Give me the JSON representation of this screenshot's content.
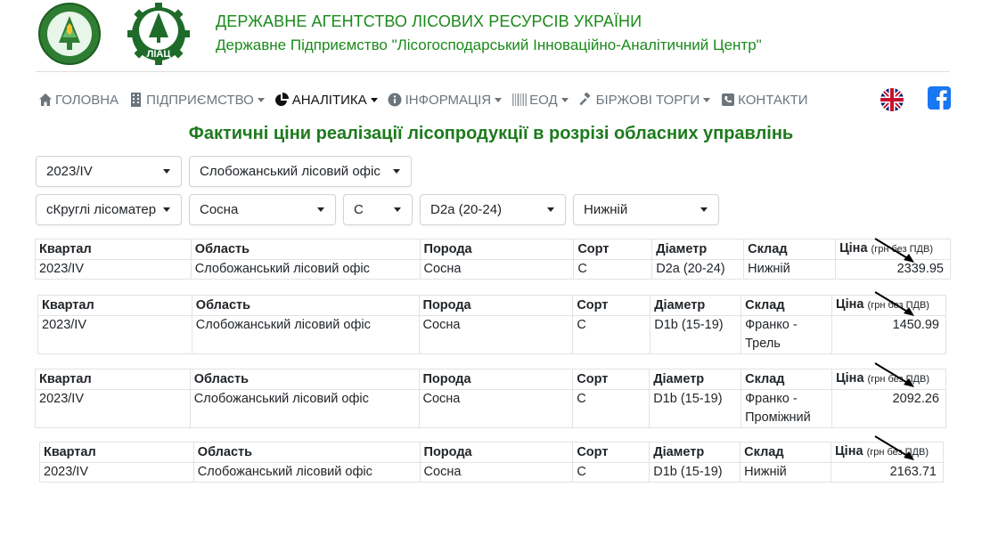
{
  "header": {
    "org_title": "ДЕРЖАВНЕ АГЕНТСТВО ЛІСОВИХ РЕСУРСІВ УКРАЇНИ",
    "org_subtitle": "Державне Підприємство \"Лісогосподарський Інноваційно-Аналітичний Центр\"",
    "logo_text": "ЛІАЦ"
  },
  "nav": [
    {
      "label": "ГОЛОВНА",
      "icon": "home-icon"
    },
    {
      "label": "ПІДПРИЄМСТВО",
      "icon": "building-icon"
    },
    {
      "label": "АНАЛІТИКА",
      "icon": "pie-chart-icon"
    },
    {
      "label": "ІНФОРМАЦІЯ",
      "icon": "info-icon"
    },
    {
      "label": "ЕОД",
      "icon": "barcode-icon"
    },
    {
      "label": "БІРЖОВІ ТОРГИ",
      "icon": "gavel-icon"
    },
    {
      "label": "КОНТАКТИ",
      "icon": "phone-icon"
    }
  ],
  "page_title": "Фактичні ціни реалізації лісопродукції в розрізі обласних управлінь",
  "filters": {
    "quarter": "2023/IV",
    "office": "Слобожанський лісовий офіс",
    "product": "сКруглі лісоматері",
    "species": "Сосна",
    "grade": "С",
    "diameter": "D2a (20-24)",
    "warehouse": "Нижній"
  },
  "table_headers": {
    "quarter": "Квартал",
    "region": "Область",
    "species": "Порода",
    "grade": "Сорт",
    "diameter": "Діаметр",
    "warehouse": "Склад",
    "price": "Ціна",
    "price_note": "(грн без ПДВ)"
  },
  "tables": [
    {
      "quarter": "2023/IV",
      "region": "Слобожанський лісовий офіс",
      "species": "Сосна",
      "grade": "С",
      "diameter": "D2a (20-24)",
      "warehouse": "Нижній",
      "price": "2339.95"
    },
    {
      "quarter": "2023/IV",
      "region": "Слобожанський лісовий офіс",
      "species": "Сосна",
      "grade": "С",
      "diameter": "D1b (15-19)",
      "warehouse": "Франко - Трель",
      "price": "1450.99"
    },
    {
      "quarter": "2023/IV",
      "region": "Слобожанський лісовий офіс",
      "species": "Сосна",
      "grade": "С",
      "diameter": "D1b (15-19)",
      "warehouse": "Франко - Проміжний",
      "price": "2092.26"
    },
    {
      "quarter": "2023/IV",
      "region": "Слобожанський лісовий офіс",
      "species": "Сосна",
      "grade": "С",
      "diameter": "D1b (15-19)",
      "warehouse": "Нижній",
      "price": "2163.71"
    }
  ],
  "colors": {
    "brand_green": "#1a8a1a",
    "title_green": "#1d7a1d",
    "facebook": "#1877f2"
  }
}
